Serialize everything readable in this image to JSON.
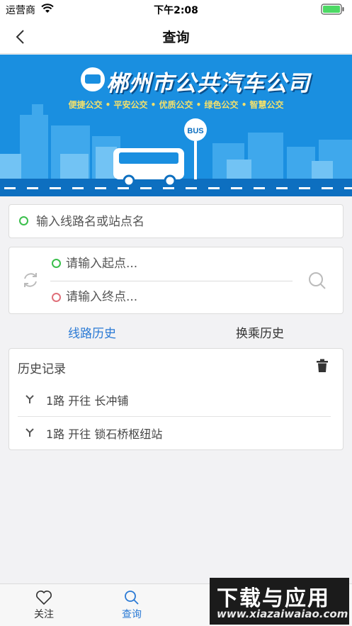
{
  "status_bar": {
    "carrier": "运营商",
    "time": "下午2:08"
  },
  "nav": {
    "title": "查询"
  },
  "banner": {
    "title": "郴州市公共汽车公司",
    "slogan": "便捷公交 • 平安公交 • 优质公交 • 绿色公交 • 智慧公交",
    "bus_sign": "BUS"
  },
  "search": {
    "placeholder": "输入线路名或站点名",
    "value": ""
  },
  "route": {
    "start_placeholder": "请输入起点...",
    "end_placeholder": "请输入终点..."
  },
  "tabs": {
    "lines": "线路历史",
    "transfer": "换乘历史"
  },
  "history": {
    "title": "历史记录",
    "items": [
      {
        "text": "1路 开往 长冲铺"
      },
      {
        "text": "1路 开往 锁石桥枢纽站"
      }
    ]
  },
  "tab_bar": {
    "follow": "关注",
    "query": "查询"
  },
  "watermark": {
    "main": "下载与应用",
    "sub": "www.xiazaiwaiao.com"
  },
  "colors": {
    "accent": "#2a7ad5",
    "banner": "#1a8fe0",
    "green_dot": "#3bbf4c",
    "red_dot": "#e0707a"
  }
}
